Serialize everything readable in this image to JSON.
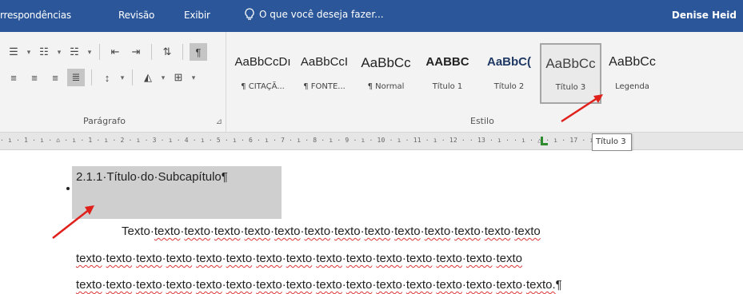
{
  "ribbon_tabs": [
    {
      "label": "rrespondências"
    },
    {
      "label": "Revisão"
    },
    {
      "label": "Exibir"
    }
  ],
  "tell_me": "O que você deseja fazer...",
  "user_name": "Denise Heid",
  "paragraph_group": {
    "label": "Parágrafo"
  },
  "styles_group": {
    "label": "Estilo"
  },
  "styles": [
    {
      "preview": "AaBbCcDı",
      "label": "¶ CITAÇÃ..."
    },
    {
      "preview": "AaBbCcI",
      "label": "¶ FONTE..."
    },
    {
      "preview": "AaBbCc",
      "label": "¶ Normal"
    },
    {
      "preview": "AABBC",
      "label": "Título 1"
    },
    {
      "preview": "AaBbC(",
      "label": "Título 2"
    },
    {
      "preview": "AaBbCc",
      "label": "Título 3"
    },
    {
      "preview": "AaBbCc",
      "label": "Legenda"
    }
  ],
  "ruler": {
    "scale": "· ı · 1 · ı · ⌂ · ı · 1 · ı · 2 · ı · 3 · ı · 4 · ı · 5 · ı · 6 · ı · 7 · ı · 8 · ı · 9 · ı · 10 · ı · 11 · ı · 12 ·   · 13 · ı ·           · ı · △ · ı · 17 · ı ·"
  },
  "tooltip": "Título 3",
  "document": {
    "heading": "2.1.1·Título·do·Subcapítulo¶",
    "line1_words": [
      "Texto",
      "texto",
      "texto",
      "texto",
      "texto",
      "texto",
      "texto",
      "texto",
      "texto",
      "texto",
      "texto",
      "texto",
      "texto",
      "texto"
    ],
    "line2_words": [
      "texto",
      "texto",
      "texto",
      "texto",
      "texto",
      "texto",
      "texto",
      "texto",
      "texto",
      "texto",
      "texto",
      "texto",
      "texto",
      "texto",
      "texto"
    ],
    "line3_words": [
      "texto",
      "texto",
      "texto",
      "texto",
      "texto",
      "texto",
      "texto",
      "texto",
      "texto",
      "texto",
      "texto",
      "texto",
      "texto",
      "texto",
      "texto",
      "texto."
    ],
    "line3_end": "¶"
  },
  "colors": {
    "ribbon_blue": "#2b579a",
    "arrow_red": "#e0201b",
    "highlight_gray": "#cfcfcf"
  }
}
